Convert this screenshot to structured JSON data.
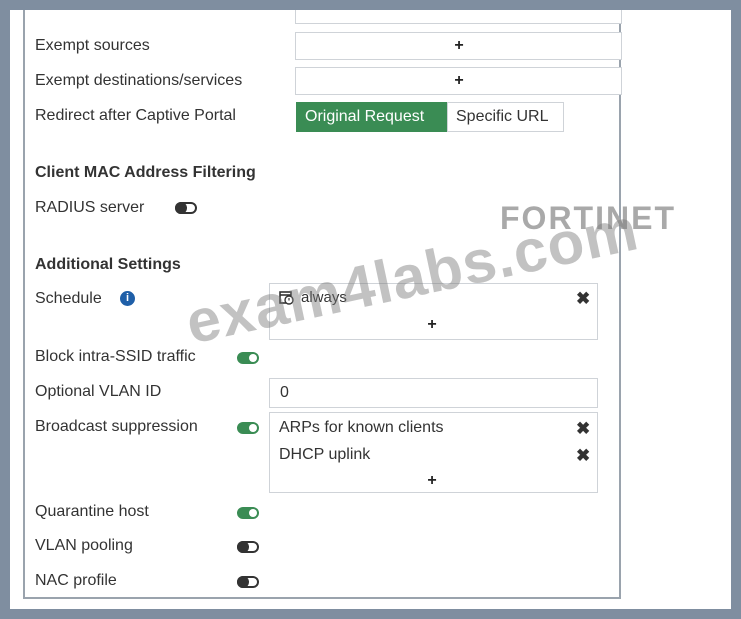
{
  "exempt_sources": {
    "label": "Exempt sources",
    "add": "+"
  },
  "exempt_destinations": {
    "label": "Exempt destinations/services",
    "add": "+"
  },
  "redirect": {
    "label": "Redirect after Captive Portal",
    "options": [
      "Original Request",
      "Specific URL"
    ],
    "selected": "Original Request"
  },
  "mac_filtering": {
    "heading": "Client MAC Address Filtering",
    "radius_label": "RADIUS server",
    "radius_enabled": false
  },
  "additional": {
    "heading": "Additional Settings",
    "schedule": {
      "label": "Schedule",
      "info": "i",
      "value": "always",
      "add": "+"
    },
    "block_intra_ssid": {
      "label": "Block intra-SSID traffic",
      "enabled": true
    },
    "optional_vlan": {
      "label": "Optional VLAN ID",
      "value": "0"
    },
    "broadcast_suppression": {
      "label": "Broadcast suppression",
      "enabled": true,
      "items": [
        "ARPs for known clients",
        "DHCP uplink"
      ],
      "add": "+"
    },
    "quarantine_host": {
      "label": "Quarantine host",
      "enabled": true
    },
    "vlan_pooling": {
      "label": "VLAN pooling",
      "enabled": false
    },
    "nac_profile": {
      "label": "NAC profile",
      "enabled": false
    }
  },
  "icons": {
    "remove": "✖",
    "schedule": "calendar-clock-icon"
  },
  "logo_text": "FORTINET",
  "watermark_text": "exam4labs.com",
  "colors": {
    "accent": "#3a8c54",
    "frame": "#7f8ea0"
  }
}
